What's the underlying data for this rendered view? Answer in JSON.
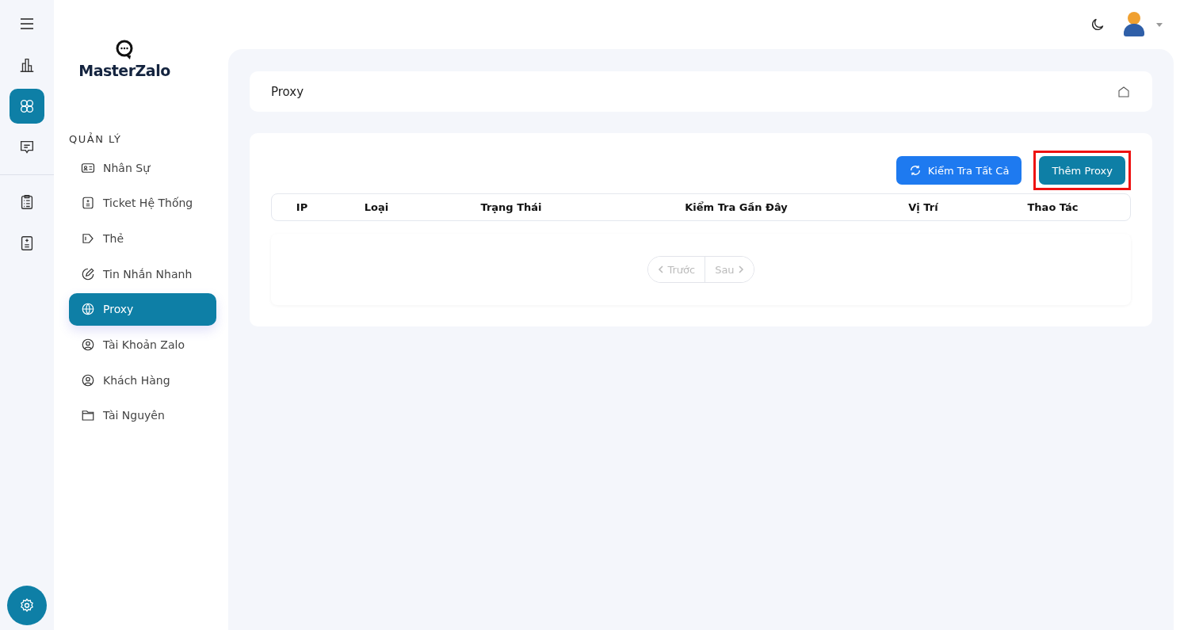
{
  "rail": {
    "items": [
      {
        "kind": "chart",
        "selected": false
      },
      {
        "kind": "apps",
        "selected": true
      },
      {
        "kind": "chat",
        "selected": false
      },
      {
        "kind": "clipboard",
        "selected": false
      },
      {
        "kind": "calc",
        "selected": false
      }
    ]
  },
  "sidebar": {
    "logo": "MasterZalo",
    "section": "QUẢN LÝ",
    "items": [
      {
        "label": "Nhân Sự",
        "kind": "idcard",
        "selected": false
      },
      {
        "label": "Ticket Hệ Thống",
        "kind": "ticket",
        "selected": false
      },
      {
        "label": "Thẻ",
        "kind": "tag",
        "selected": false
      },
      {
        "label": "Tin Nhắn Nhanh",
        "kind": "pen",
        "selected": false
      },
      {
        "label": "Proxy",
        "kind": "globe",
        "selected": true
      },
      {
        "label": "Tài Khoản Zalo",
        "kind": "user",
        "selected": false
      },
      {
        "label": "Khách Hàng",
        "kind": "user",
        "selected": false
      },
      {
        "label": "Tài Nguyên",
        "kind": "folder",
        "selected": false
      }
    ]
  },
  "page": {
    "title": "Proxy"
  },
  "buttons": [
    {
      "label": "Kiểm Tra Tất Cả",
      "kind": "refresh",
      "highlighted": false
    },
    {
      "label": "Thêm Proxy",
      "kind": "plain",
      "highlighted": true
    }
  ],
  "table": {
    "columns": [
      "IP",
      "Loại",
      "Trạng Thái",
      "Kiểm Tra Gần Đây",
      "Vị Trí",
      "Thao Tác"
    ]
  },
  "pagination": {
    "prev": "Trước",
    "next": "Sau",
    "disabled": true
  }
}
